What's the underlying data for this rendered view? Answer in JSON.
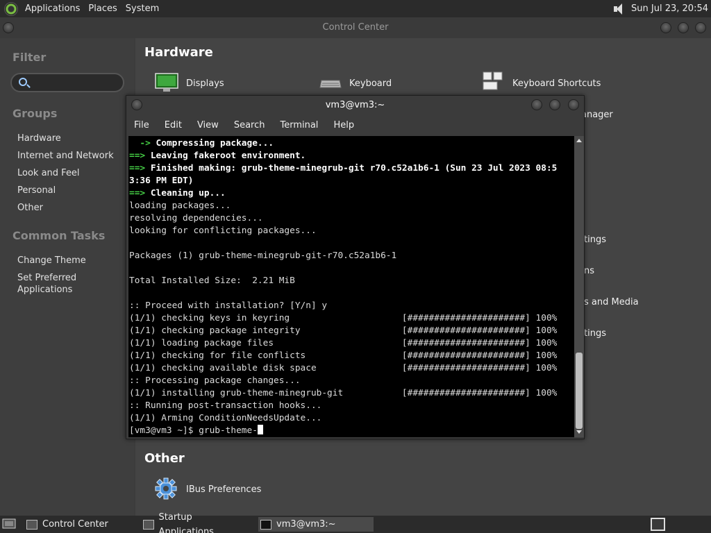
{
  "top_panel": {
    "menus": [
      "Applications",
      "Places",
      "System"
    ],
    "clock": "Sun Jul 23, 20:54",
    "icons": [
      "distro-logo-icon",
      "speaker-icon"
    ]
  },
  "control_center": {
    "title": "Control Center",
    "sidebar": {
      "filter_heading": "Filter",
      "groups_heading": "Groups",
      "groups": [
        "Hardware",
        "Internet and Network",
        "Look and Feel",
        "Personal",
        "Other"
      ],
      "tasks_heading": "Common Tasks",
      "tasks": [
        "Change Theme",
        "Set Preferred Applications"
      ]
    },
    "main": {
      "hardware_title": "Hardware",
      "hardware_items": [
        "Displays",
        "Keyboard",
        "Keyboard Shortcuts"
      ],
      "partial_items": [
        "anager",
        "tings",
        "ns",
        "s and Media",
        "tings"
      ],
      "other_title": "Other",
      "other_items": [
        "IBus Preferences"
      ]
    }
  },
  "terminal": {
    "title": "vm3@vm3:~",
    "menu": [
      "File",
      "Edit",
      "View",
      "Search",
      "Terminal",
      "Help"
    ],
    "lines": [
      {
        "prefix": "  ->",
        "text": " Compressing package...",
        "style": "arrow-bold"
      },
      {
        "prefix": "==>",
        "text": " Leaving fakeroot environment.",
        "style": "arrow-bold"
      },
      {
        "prefix": "==>",
        "text": " Finished making: grub-theme-minegrub-git r70.c52a1b6-1 (Sun 23 Jul 2023 08:5",
        "style": "arrow-bold"
      },
      {
        "prefix": "",
        "text": "3:36 PM EDT)",
        "style": "bold"
      },
      {
        "prefix": "==>",
        "text": " Cleaning up...",
        "style": "arrow-bold"
      },
      {
        "prefix": "",
        "text": "loading packages...",
        "style": "plain"
      },
      {
        "prefix": "",
        "text": "resolving dependencies...",
        "style": "plain"
      },
      {
        "prefix": "",
        "text": "looking for conflicting packages...",
        "style": "plain"
      },
      {
        "prefix": "",
        "text": "",
        "style": "plain"
      },
      {
        "prefix": "",
        "text": "Packages (1) grub-theme-minegrub-git-r70.c52a1b6-1",
        "style": "plain"
      },
      {
        "prefix": "",
        "text": "",
        "style": "plain"
      },
      {
        "prefix": "",
        "text": "Total Installed Size:  2.21 MiB",
        "style": "plain"
      },
      {
        "prefix": "",
        "text": "",
        "style": "plain"
      },
      {
        "prefix": "",
        "text": ":: Proceed with installation? [Y/n] y",
        "style": "plain"
      },
      {
        "prefix": "",
        "text": "(1/1) checking keys in keyring                     [######################] 100%",
        "style": "plain"
      },
      {
        "prefix": "",
        "text": "(1/1) checking package integrity                   [######################] 100%",
        "style": "plain"
      },
      {
        "prefix": "",
        "text": "(1/1) loading package files                        [######################] 100%",
        "style": "plain"
      },
      {
        "prefix": "",
        "text": "(1/1) checking for file conflicts                  [######################] 100%",
        "style": "plain"
      },
      {
        "prefix": "",
        "text": "(1/1) checking available disk space                [######################] 100%",
        "style": "plain"
      },
      {
        "prefix": "",
        "text": ":: Processing package changes...",
        "style": "plain"
      },
      {
        "prefix": "",
        "text": "(1/1) installing grub-theme-minegrub-git           [######################] 100%",
        "style": "plain"
      },
      {
        "prefix": "",
        "text": ":: Running post-transaction hooks...",
        "style": "plain"
      },
      {
        "prefix": "",
        "text": "(1/1) Arming ConditionNeedsUpdate...",
        "style": "plain"
      },
      {
        "prefix": "",
        "text": "[vm3@vm3 ~]$ grub-theme-",
        "style": "prompt"
      }
    ]
  },
  "taskbar": {
    "tasks": [
      {
        "label": "Control Center",
        "active": false
      },
      {
        "label": "Startup Applications...",
        "active": false
      },
      {
        "label": "vm3@vm3:~",
        "active": true
      }
    ]
  },
  "colors": {
    "accent_green": "#46d046",
    "terminal_bg": "#000000",
    "panel_bg": "#2b2b2b"
  }
}
